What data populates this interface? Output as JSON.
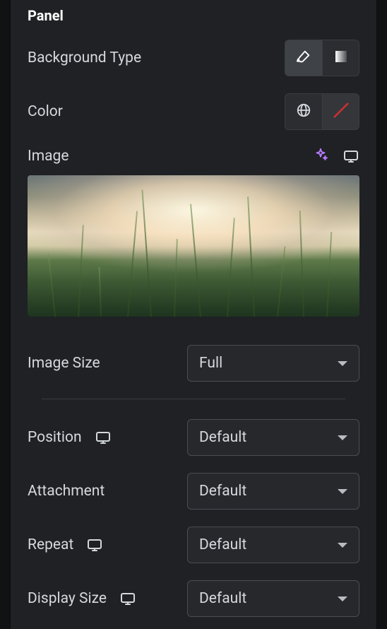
{
  "section": {
    "title": "Panel"
  },
  "backgroundType": {
    "label": "Background Type",
    "options": [
      "classic",
      "gradient"
    ],
    "active": "classic"
  },
  "color": {
    "label": "Color",
    "global": true,
    "value": "none"
  },
  "image": {
    "label": "Image"
  },
  "imageSize": {
    "label": "Image Size",
    "value": "Full"
  },
  "position": {
    "label": "Position",
    "value": "Default"
  },
  "attachment": {
    "label": "Attachment",
    "value": "Default"
  },
  "repeat": {
    "label": "Repeat",
    "value": "Default"
  },
  "displaySize": {
    "label": "Display Size",
    "value": "Default"
  }
}
